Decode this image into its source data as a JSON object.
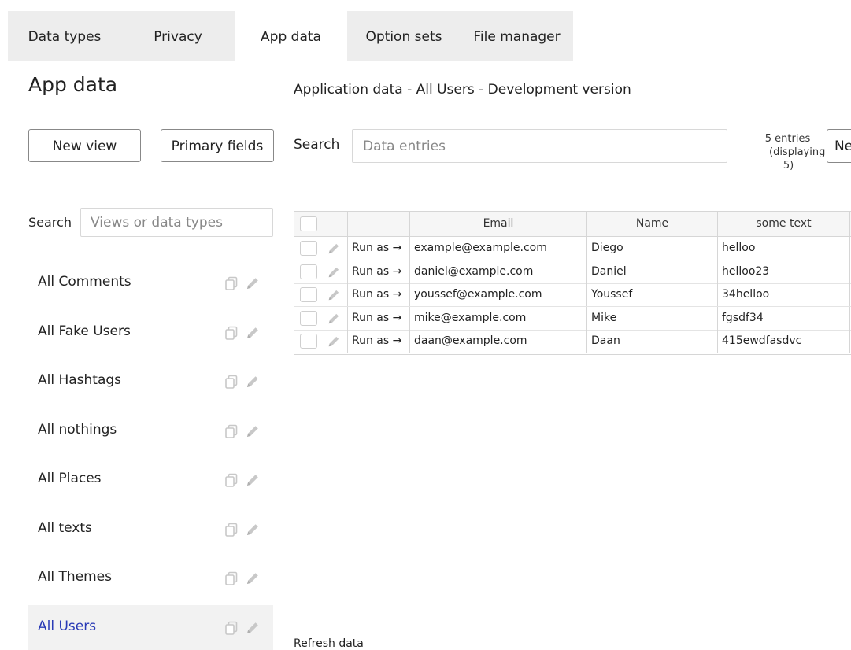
{
  "tabs": [
    "Data types",
    "Privacy",
    "App data",
    "Option sets",
    "File manager"
  ],
  "active_tab": "App data",
  "left_panel": {
    "title": "App data",
    "new_view_label": "New view",
    "primary_fields_label": "Primary fields",
    "search_label": "Search",
    "search_placeholder": "Views or data types",
    "views": [
      {
        "label": "All Comments"
      },
      {
        "label": "All Fake Users"
      },
      {
        "label": "All Hashtags"
      },
      {
        "label": "All nothings"
      },
      {
        "label": "All Places"
      },
      {
        "label": "All texts"
      },
      {
        "label": "All Themes"
      },
      {
        "label": "All Users",
        "active": true
      }
    ]
  },
  "main": {
    "title": "Application data - All Users - Development version",
    "search_label": "Search",
    "search_placeholder": "Data entries",
    "entries_count_line1": "5 entries",
    "entries_count_line2": "(displaying",
    "entries_count_line3": "5)",
    "new_entry_label": "New entry",
    "columns": [
      "Email",
      "Name",
      "some text"
    ],
    "run_as_label": "Run as →",
    "rows": [
      {
        "email": "example@example.com",
        "name": "Diego",
        "text": "helloo"
      },
      {
        "email": "daniel@example.com",
        "name": "Daniel",
        "text": "helloo23"
      },
      {
        "email": "youssef@example.com",
        "name": "Youssef",
        "text": "34helloo"
      },
      {
        "email": "mike@example.com",
        "name": "Mike",
        "text": "fgsdf34"
      },
      {
        "email": "daan@example.com",
        "name": "Daan",
        "text": "415ewdfasdvc"
      }
    ],
    "refresh_label": "Refresh data"
  },
  "colors": {
    "active_view": "#2a3bb6",
    "tabbar_bg": "#ededed",
    "icon_gray": "#c8c8c8"
  }
}
